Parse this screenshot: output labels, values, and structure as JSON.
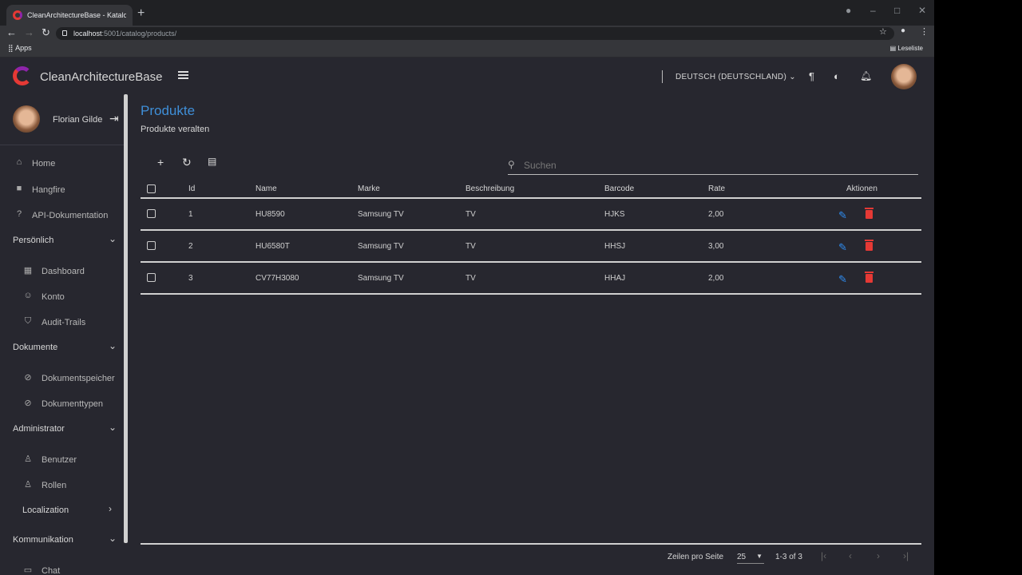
{
  "browser": {
    "tab_title": "CleanArchitectureBase - Katalog",
    "url_host": "localhost",
    "url_rest": ":5001/catalog/products/",
    "bookmarks_apps": "Apps",
    "reading_list": "Leseliste"
  },
  "appbar": {
    "title": "CleanArchitectureBase",
    "language": "DEUTSCH (DEUTSCHLAND)"
  },
  "sidebar": {
    "user_name": "Florian Gilde",
    "items": [
      {
        "label": "Home",
        "icon": "home-icon"
      },
      {
        "label": "Hangfire",
        "icon": "briefcase-icon"
      },
      {
        "label": "API-Dokumentation",
        "icon": "help-icon"
      },
      {
        "label": "Persönlich",
        "group": true
      },
      {
        "label": "Dashboard",
        "icon": "dashboard-icon"
      },
      {
        "label": "Konto",
        "icon": "account-icon"
      },
      {
        "label": "Audit-Trails",
        "icon": "shield-icon"
      },
      {
        "label": "Dokumente",
        "group": true
      },
      {
        "label": "Dokumentspeicher",
        "icon": "paperclip-icon"
      },
      {
        "label": "Dokumenttypen",
        "icon": "paperclip-icon"
      },
      {
        "label": "Administrator",
        "group": true
      },
      {
        "label": "Benutzer",
        "icon": "person-icon"
      },
      {
        "label": "Rollen",
        "icon": "person-icon"
      },
      {
        "label": "Localization",
        "group": true
      },
      {
        "label": "Kommunikation",
        "group": true
      },
      {
        "label": "Chat",
        "icon": "chat-icon"
      }
    ]
  },
  "page": {
    "title": "Produkte",
    "subtitle": "Produkte veralten"
  },
  "search": {
    "placeholder": "Suchen"
  },
  "table": {
    "headers": [
      "Id",
      "Name",
      "Marke",
      "Beschreibung",
      "Barcode",
      "Rate",
      "Aktionen"
    ],
    "rows": [
      {
        "id": "1",
        "name": "HU8590",
        "brand": "Samsung TV",
        "description": "TV",
        "barcode": "HJKS",
        "rate": "2,00"
      },
      {
        "id": "2",
        "name": "HU6580T",
        "brand": "Samsung TV",
        "description": "TV",
        "barcode": "HHSJ",
        "rate": "3,00"
      },
      {
        "id": "3",
        "name": "CV77H3080",
        "brand": "Samsung TV",
        "description": "TV",
        "barcode": "HHAJ",
        "rate": "2,00"
      }
    ]
  },
  "pagination": {
    "rows_per_page_label": "Zeilen pro Seite",
    "rows_per_page": "25",
    "range": "1-3 of 3"
  },
  "colors": {
    "accent": "#3f8fd8",
    "edit": "#2f8cf0",
    "delete": "#e53935"
  }
}
